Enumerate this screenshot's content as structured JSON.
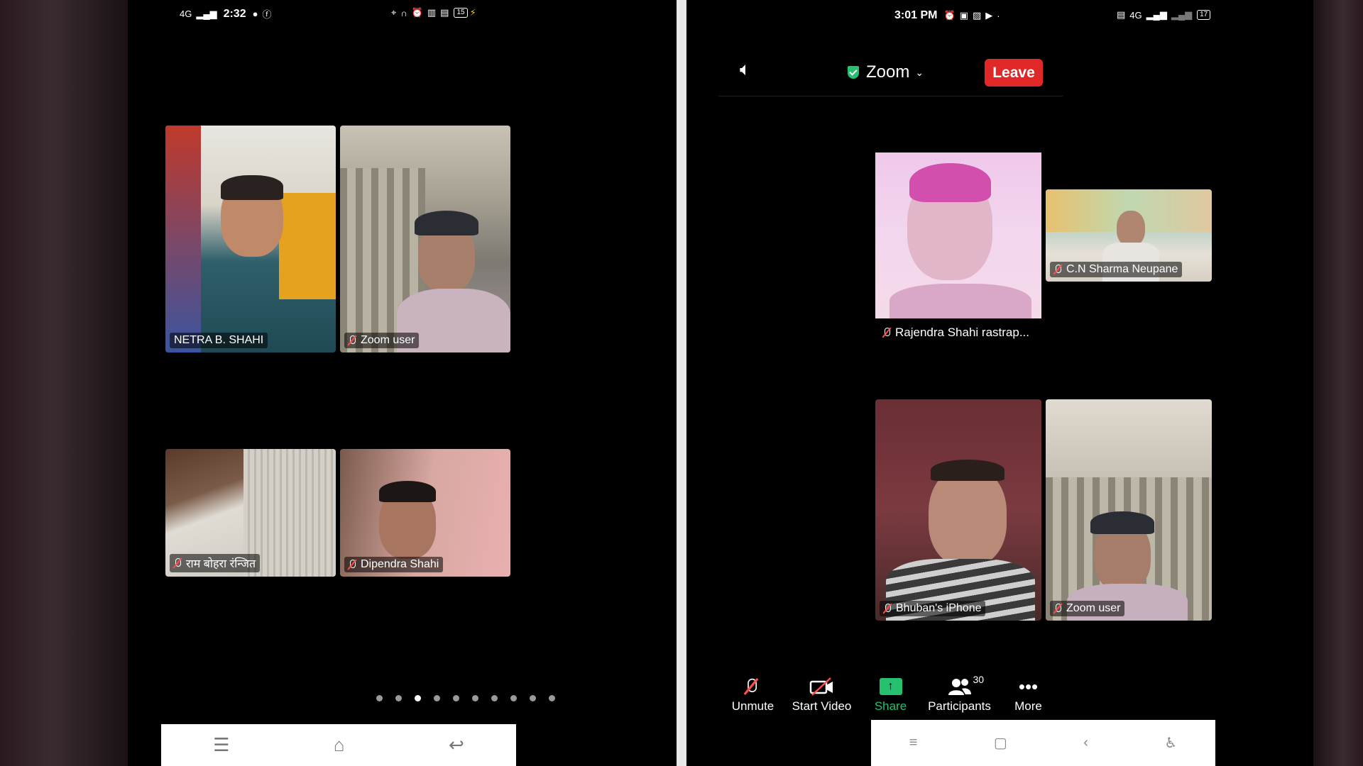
{
  "left_phone": {
    "status": {
      "network": "4G",
      "time": "2:32",
      "battery": "15"
    },
    "tiles": [
      {
        "name": "NETRA B. SHAHI",
        "muted": false
      },
      {
        "name": "Zoom user",
        "muted": true
      },
      {
        "name": "राम बोहरा रंन्जित",
        "muted": true
      },
      {
        "name": "Dipendra Shahi",
        "muted": true
      }
    ],
    "pages": 10,
    "active_page": 3
  },
  "right_phone": {
    "status": {
      "time": "3:01 PM",
      "network": "4G",
      "battery": "17"
    },
    "meeting_title": "Zoom",
    "leave_label": "Leave",
    "tiles": [
      {
        "name": "Rajendra Shahi rastrap...",
        "muted": true
      },
      {
        "name": "C.N Sharma Neupane",
        "muted": true
      },
      {
        "name": "Bhuban's iPhone",
        "muted": true
      },
      {
        "name": "Zoom user",
        "muted": true
      }
    ],
    "toolbar": {
      "unmute": "Unmute",
      "start_video": "Start Video",
      "share": "Share",
      "participants": "Participants",
      "participants_count": "30",
      "more": "More"
    }
  },
  "colors": {
    "accent_green": "#25c16f",
    "leave_red": "#e02828"
  }
}
